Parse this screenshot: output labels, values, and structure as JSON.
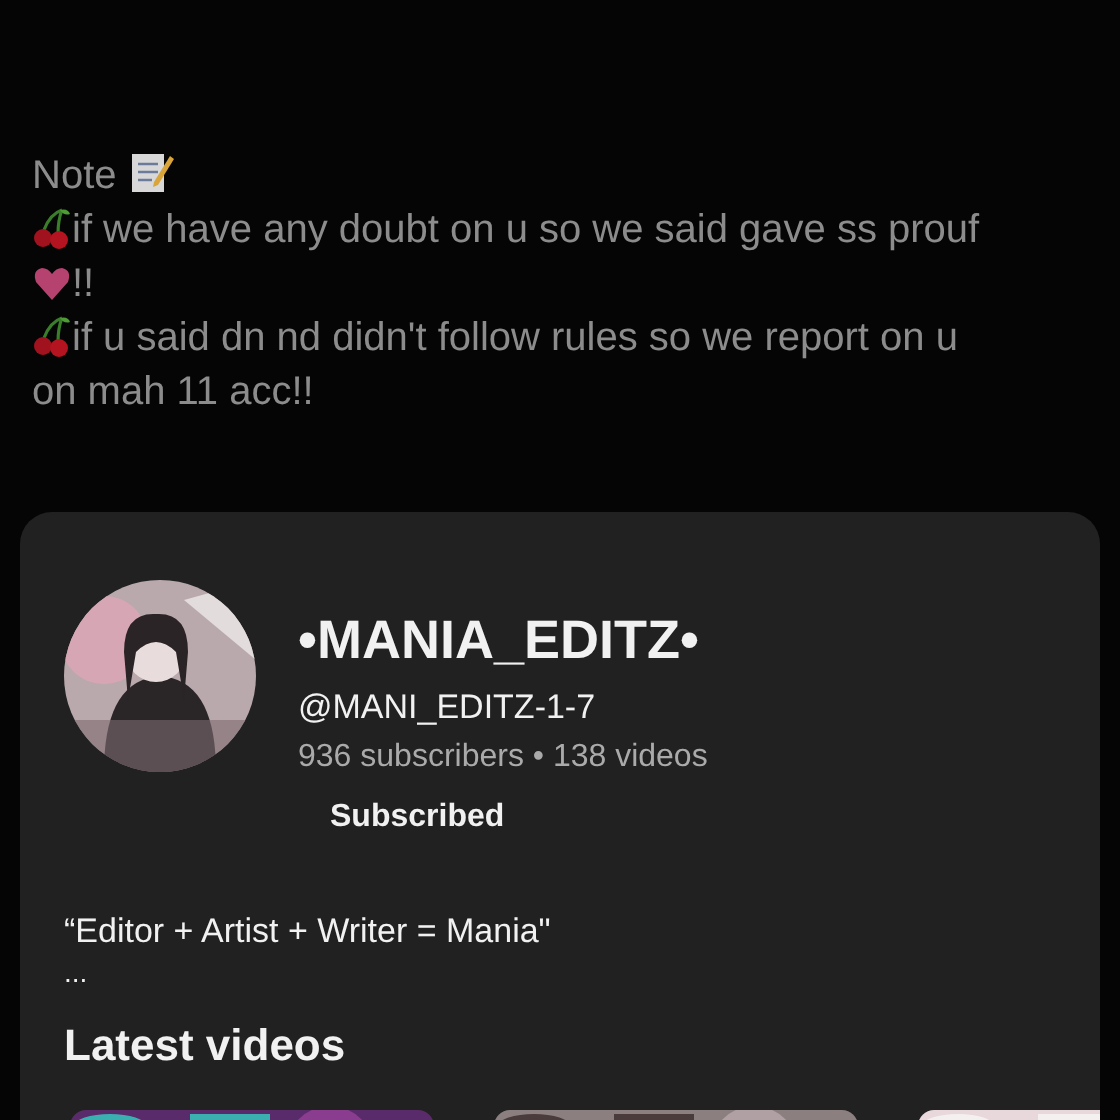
{
  "note": {
    "title": "Note",
    "rules": [
      {
        "lines": [
          "if we have any doubt on u so we said gave ss prouf"
        ],
        "after": "!!"
      },
      {
        "lines": [
          "if u said dn nd didn't follow rules so we report on u",
          "on mah 11 acc!!"
        ]
      }
    ]
  },
  "channel": {
    "name": "•MANIA_EDITZ•",
    "handle": "@MANI_EDITZ-1-7",
    "stats": "936 subscribers • 138 videos",
    "button": "Subscribed",
    "description": "“Editor + Artist + Writer = Mania\"",
    "more": "..."
  },
  "latest": {
    "title": "Latest videos"
  }
}
